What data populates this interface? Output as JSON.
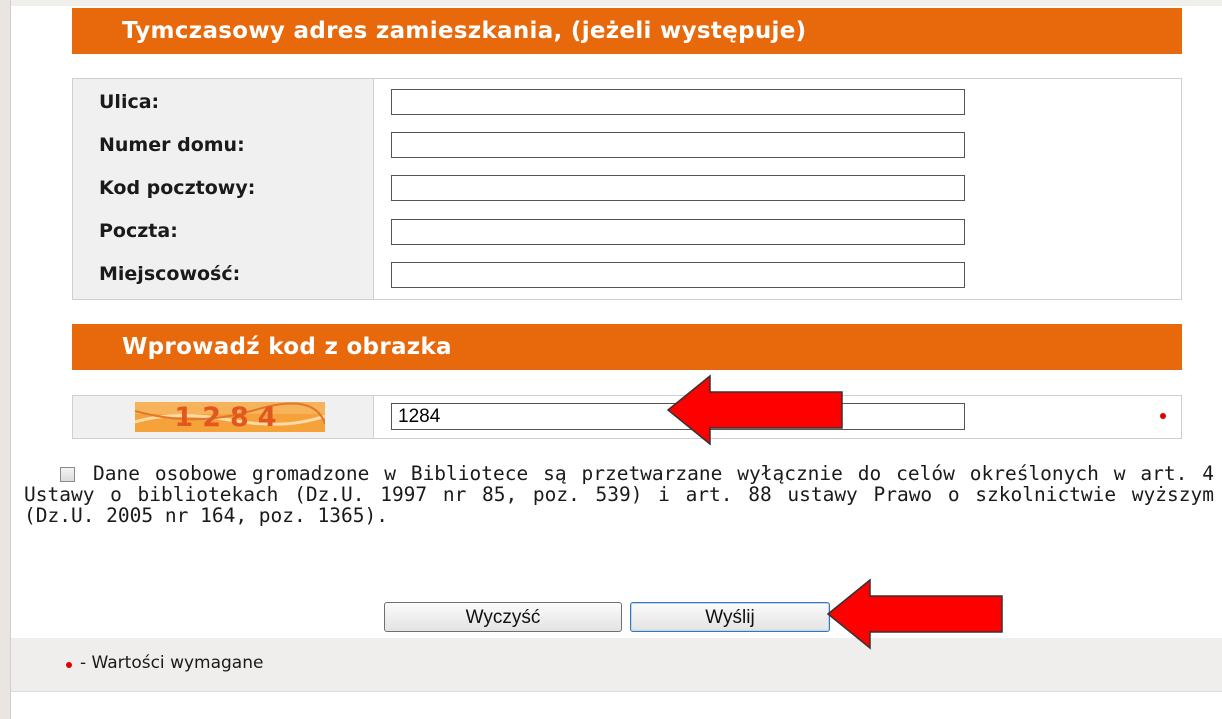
{
  "temp_address": {
    "header": "Tymczasowy adres zamieszkania, (jeżeli występuje)",
    "fields": [
      {
        "label": "Ulica:",
        "value": ""
      },
      {
        "label": "Numer domu:",
        "value": ""
      },
      {
        "label": "Kod pocztowy:",
        "value": ""
      },
      {
        "label": "Poczta:",
        "value": ""
      },
      {
        "label": "Miejscowość:",
        "value": ""
      }
    ]
  },
  "captcha": {
    "header": "Wprowadź kod z obrazka",
    "image_text": "1284",
    "value": "1284"
  },
  "consent": {
    "checked": false,
    "text": "Dane osobowe gromadzone w Bibliotece są przetwarzane wyłącznie do celów określonych w art. 4 Ustawy o bibliotekach (Dz.U. 1997 nr 85, poz. 539) i art. 88 ustawy Prawo o szkolnictwie wyższym (Dz.U. 2005 nr 164, poz. 1365)."
  },
  "buttons": {
    "clear": "Wyczyść",
    "send": "Wyślij"
  },
  "footer": {
    "legend": "- Wartości wymagane"
  },
  "colors": {
    "header_orange": "#e8690b",
    "required_red": "#e00000",
    "annotation_arrow": "#ff0000"
  },
  "icons": {
    "annotation": "arrow-left-icon"
  }
}
